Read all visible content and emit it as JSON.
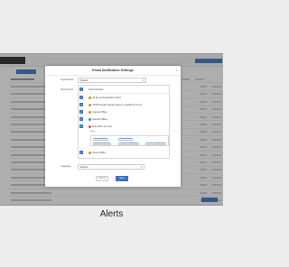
{
  "modal": {
    "title": "Email Notification Settings",
    "close_glyph": "×",
    "organization_label": "Organization",
    "organization_value": "Default",
    "alert_events_label": "Alert Events",
    "select_all_label": "Select All Alerts",
    "alerts": [
      {
        "label": "All Events Registration Failed",
        "icon": "warning-dot",
        "color": "#e58a2e"
      },
      {
        "label": "ONVIF Stream Storage Space is Insufficient or Full",
        "icon": "warning-dot",
        "color": "#e58a2e"
      },
      {
        "label": "Camera Offline",
        "icon": "warning-dot",
        "color": "#e58a2e"
      },
      {
        "label": "Network Offline",
        "icon": "info-dot",
        "color": "#4a84d2"
      },
      {
        "label": "Rule Alarm (4 more)",
        "icon": "alarm-dot",
        "color": "#d9534f"
      },
      {
        "label": "Device Offline",
        "icon": "warning-dot",
        "color": "#e58a2e"
      }
    ],
    "rules_label": "Rules",
    "rule_tags": [
      "Meeting Room",
      "Parking Room",
      "Upgrade Firmware",
      "Custom Config Reset",
      "Custom Config Profile"
    ],
    "language_label": "Language",
    "language_value": "English",
    "cancel_label": "Cancel",
    "save_label": "Save"
  },
  "background_rows": 18,
  "caption": "Alerts",
  "colors": {
    "primary": "#3d72c4",
    "warning": "#e58a2e",
    "overlay": "rgba(0,0,0,0.30)"
  }
}
